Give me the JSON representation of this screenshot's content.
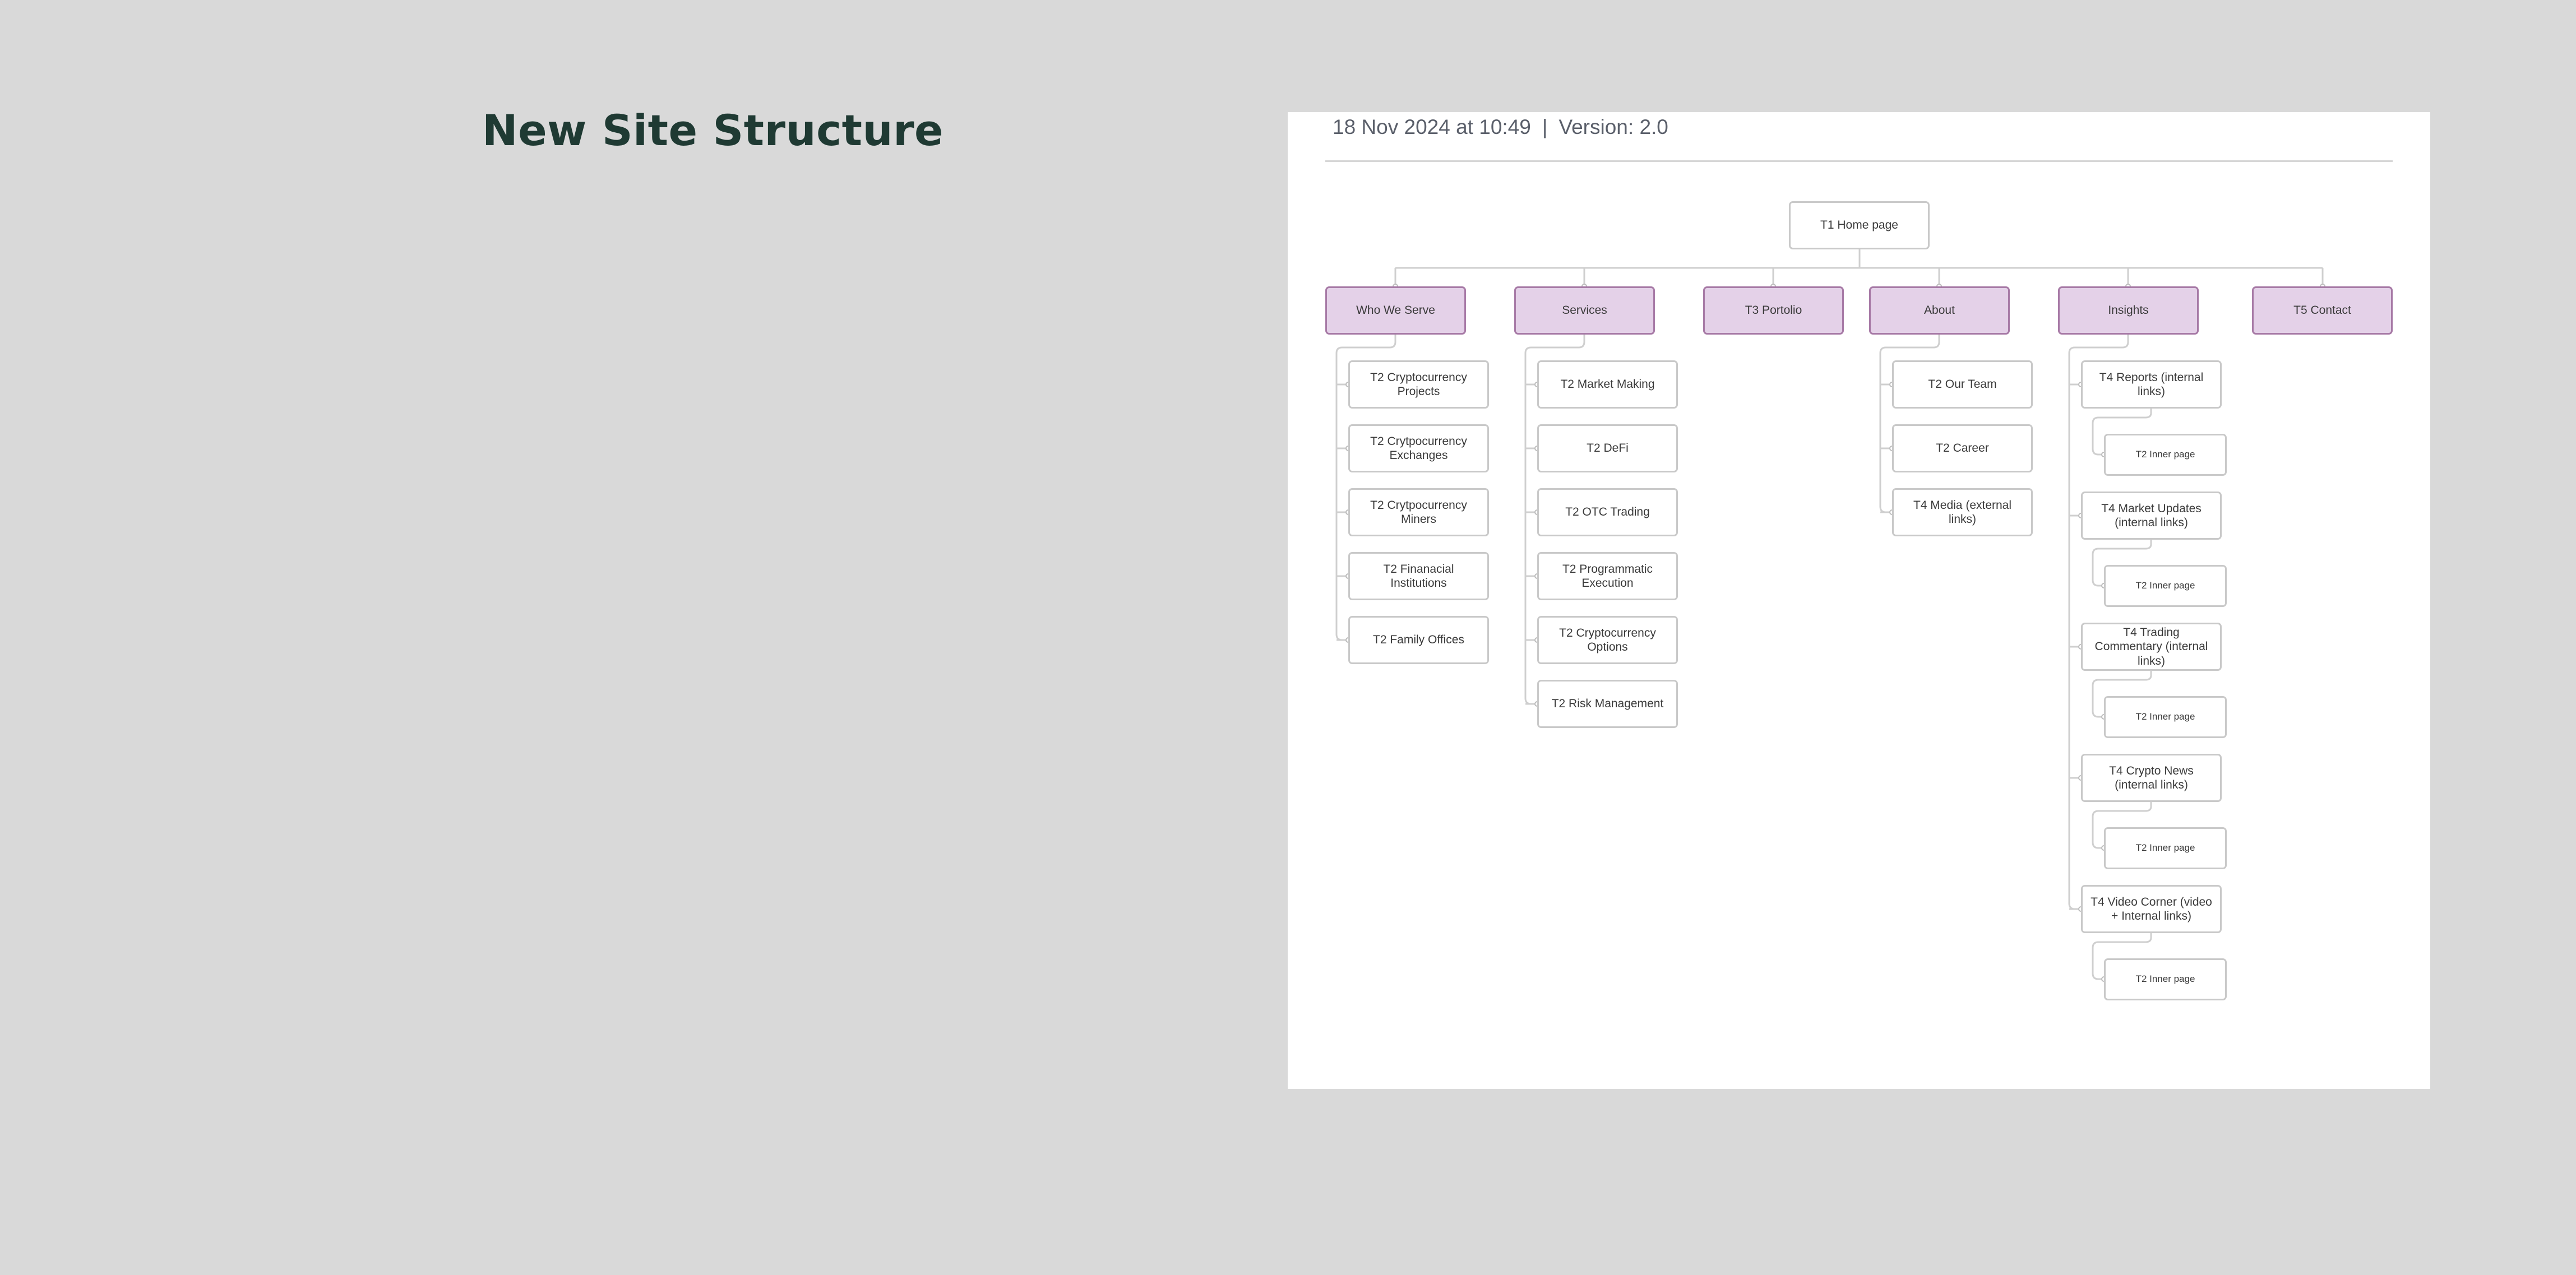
{
  "title": "New Site Structure",
  "meta": {
    "date": "18 Nov 2024 at 10:49",
    "separator": "|",
    "version": "Version: 2.0"
  },
  "sitemap": {
    "root": "T1 Home page",
    "sections": [
      {
        "label": "Who We Serve",
        "children": [
          {
            "label": "T2 Cryptocurrency Projects"
          },
          {
            "label": "T2 Crytpocurrency Exchanges"
          },
          {
            "label": "T2 Crytpocurrency Miners"
          },
          {
            "label": "T2 Finanacial Institutions"
          },
          {
            "label": "T2 Family Offices"
          }
        ]
      },
      {
        "label": "Services",
        "children": [
          {
            "label": "T2 Market Making"
          },
          {
            "label": "T2 DeFi"
          },
          {
            "label": "T2 OTC Trading"
          },
          {
            "label": "T2 Programmatic Execution"
          },
          {
            "label": "T2 Cryptocurrency Options"
          },
          {
            "label": "T2 Risk Management"
          }
        ]
      },
      {
        "label": "T3 Portolio",
        "children": []
      },
      {
        "label": "About",
        "children": [
          {
            "label": "T2 Our Team"
          },
          {
            "label": "T2 Career"
          },
          {
            "label": "T4 Media (external links)"
          }
        ]
      },
      {
        "label": "Insights",
        "children": [
          {
            "label": "T4 Reports (internal links)",
            "inner": "T2 Inner page"
          },
          {
            "label": "T4 Market Updates (internal links)",
            "inner": "T2 Inner page"
          },
          {
            "label": "T4 Trading Commentary (internal links)",
            "inner": "T2 Inner page"
          },
          {
            "label": "T4 Crypto News (internal links)",
            "inner": "T2 Inner page"
          },
          {
            "label": "T4 Video Corner (video + Internal links)",
            "inner": "T2 Inner page"
          }
        ]
      },
      {
        "label": "T5 Contact",
        "children": []
      }
    ]
  },
  "colors": {
    "section_fill": "#e4d1e8",
    "section_border": "#a77aa6",
    "node_border": "#c9c9c9",
    "connector": "#cfcfcf",
    "title": "#1f3a33"
  }
}
